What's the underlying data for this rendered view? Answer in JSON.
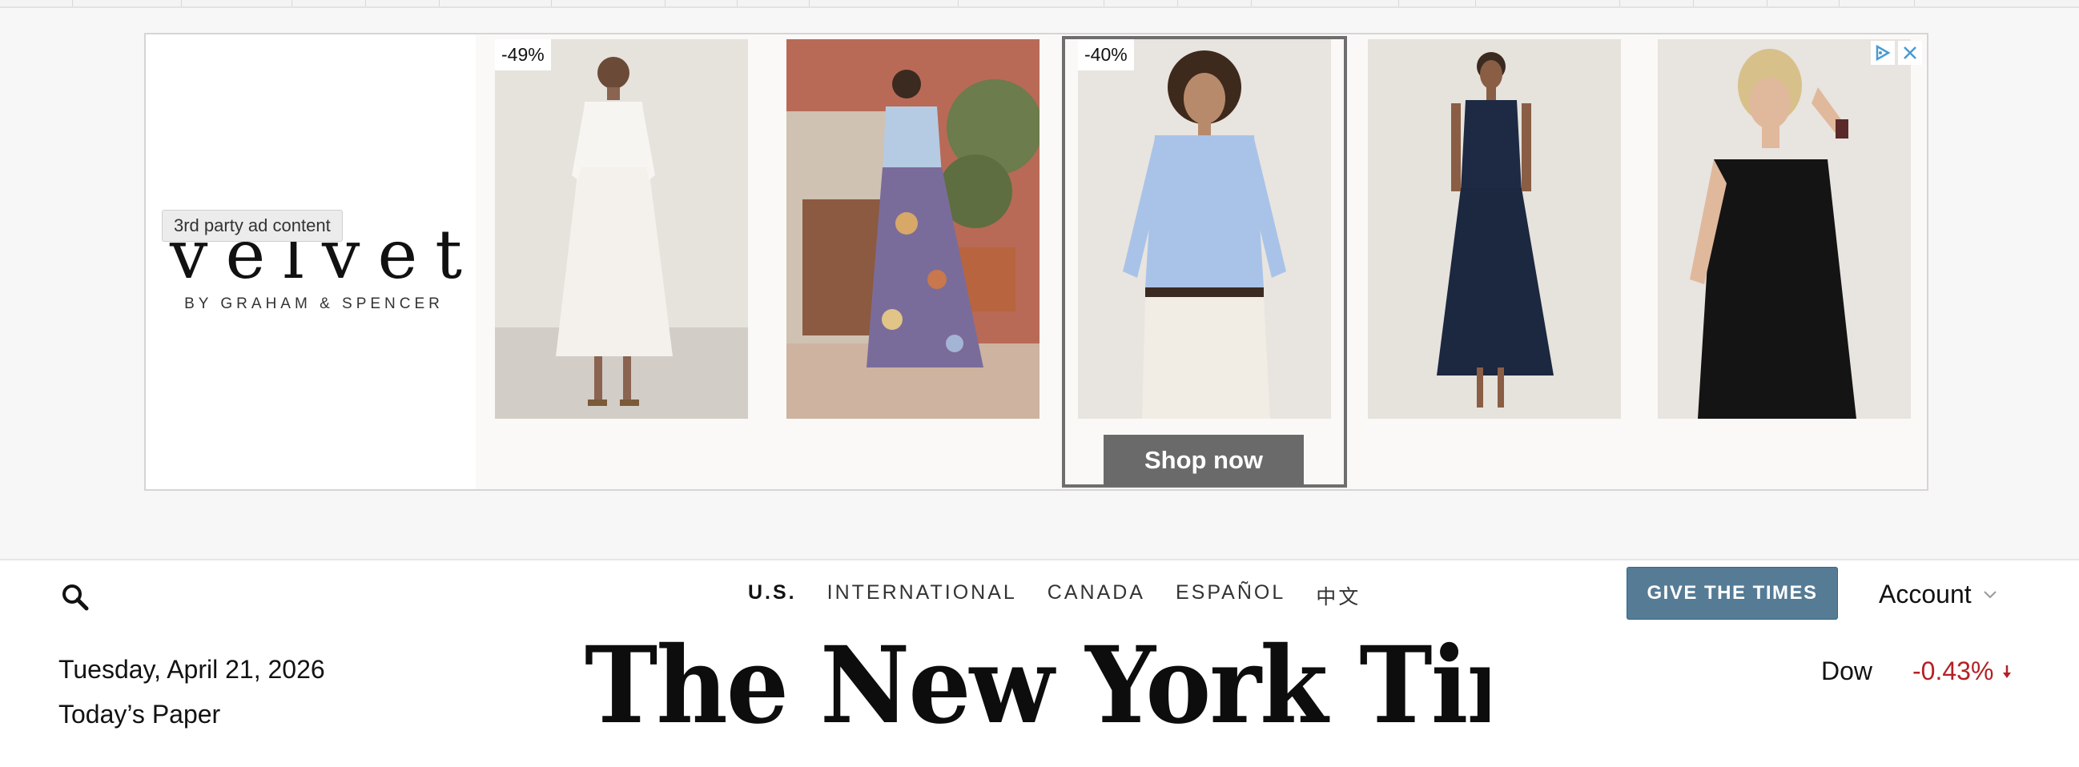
{
  "ad": {
    "brand": {
      "name": "velvet",
      "tagline": "BY GRAHAM & SPENCER"
    },
    "tooltip": "3rd party ad content",
    "products": [
      {
        "discount": "-49%",
        "desc": "white dress"
      },
      {
        "discount": "",
        "desc": "floral skirt with blue shirt"
      },
      {
        "discount": "-40%",
        "desc": "blue shirt with cream pants"
      },
      {
        "discount": "",
        "desc": "navy sleeveless dress"
      },
      {
        "discount": "",
        "desc": "black sleeveless top"
      }
    ],
    "cta": "Shop now",
    "icons": {
      "adchoices": "adchoices-icon",
      "close": "close-icon"
    }
  },
  "nav": {
    "editions": [
      {
        "label": "U.S.",
        "active": true
      },
      {
        "label": "INTERNATIONAL",
        "active": false
      },
      {
        "label": "CANADA",
        "active": false
      },
      {
        "label": "ESPAÑOL",
        "active": false
      },
      {
        "label": "中文",
        "active": false
      }
    ],
    "give_label": "GIVE THE TIMES",
    "account_label": "Account"
  },
  "masthead": {
    "date": "Tuesday, April 21, 2026",
    "todays_paper": "Today’s Paper",
    "logo": "The New York Times"
  },
  "markets": {
    "label": "Dow",
    "change": "-0.43%",
    "direction": "down",
    "color": "#b52024"
  },
  "colors": {
    "give_button": "#567b95",
    "shop_button": "#6a6a6a",
    "negative": "#b52024"
  }
}
